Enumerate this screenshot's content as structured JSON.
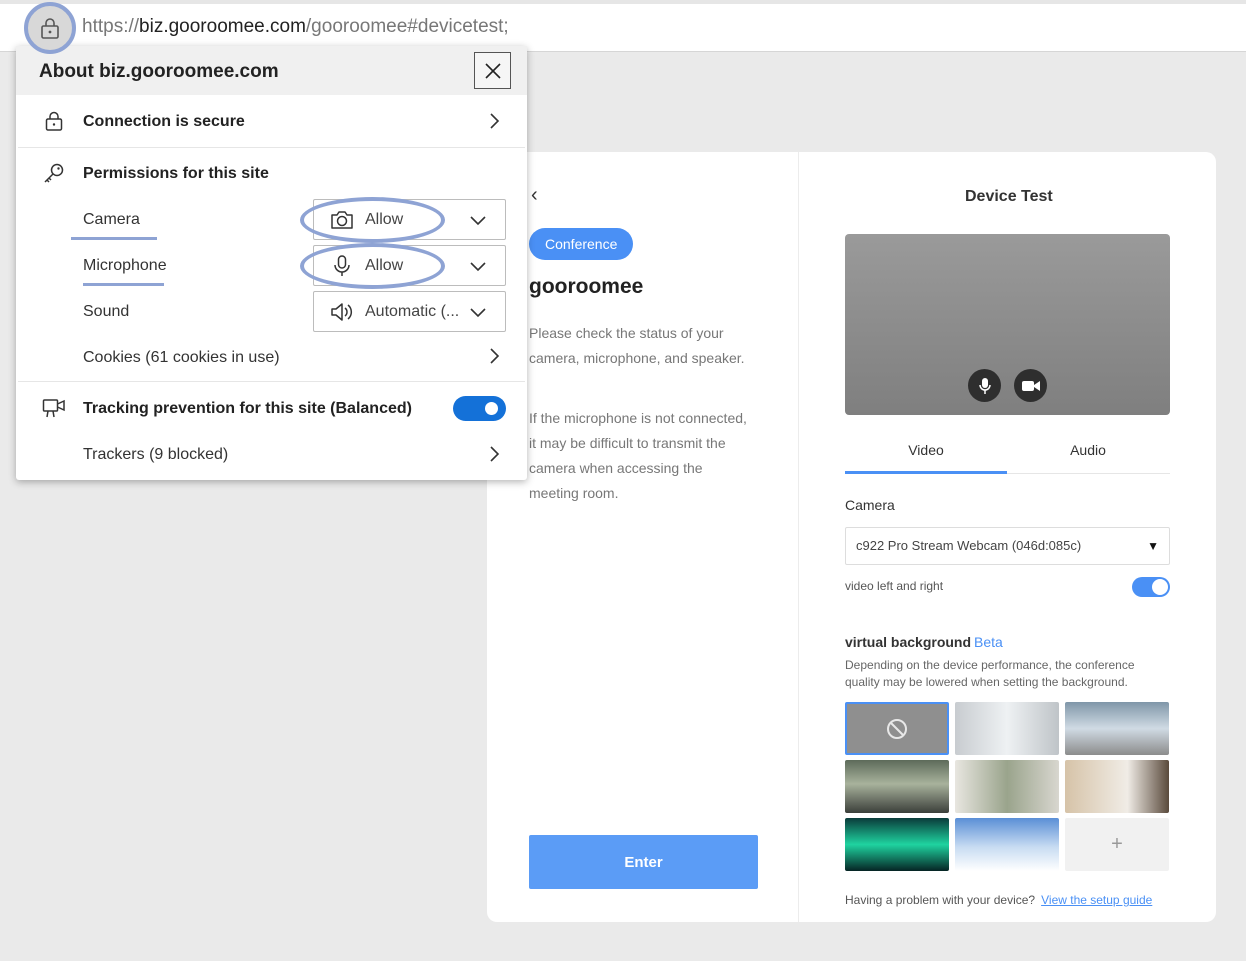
{
  "address_bar": {
    "url_prefix": "https://",
    "url_host": "biz.gooroomee.com",
    "url_path": "/gooroomee#devicetest;"
  },
  "popup": {
    "title": "About biz.gooroomee.com",
    "connection": "Connection is secure",
    "permissions_heading": "Permissions for this site",
    "camera": {
      "label": "Camera",
      "value": "Allow"
    },
    "microphone": {
      "label": "Microphone",
      "value": "Allow"
    },
    "sound": {
      "label": "Sound",
      "value": "Automatic (..."
    },
    "cookies": "Cookies (61 cookies in use)",
    "tracking": "Tracking prevention for this site (Balanced)",
    "tracking_enabled": true,
    "trackers": "Trackers (9 blocked)"
  },
  "page": {
    "conference_pill": "Conference",
    "brand": "gooroomee",
    "desc1": "Please check the status of your camera, microphone, and speaker.",
    "desc2": "If the microphone is not connected, it may be difficult to transmit the camera when accessing the meeting room.",
    "enter_label": "Enter",
    "device_test_title": "Device Test",
    "tabs": [
      {
        "label": "Video",
        "active": true
      },
      {
        "label": "Audio",
        "active": false
      }
    ],
    "camera_label": "Camera",
    "camera_value": "c922 Pro Stream Webcam (046d:085c)",
    "mirror_label": "video left and right",
    "mirror_enabled": true,
    "vb_title": "virtual background",
    "vb_beta": "Beta",
    "vb_desc": "Depending on the device performance, the conference quality may be lowered when setting the background.",
    "add_bg_glyph": "+",
    "help_text": "Having a problem with your device?",
    "help_link": "View the setup guide"
  },
  "colors": {
    "accent": "#4a90f5",
    "toggle_edge": "#1471d8",
    "annotation_ring": "#8ea3d4"
  }
}
